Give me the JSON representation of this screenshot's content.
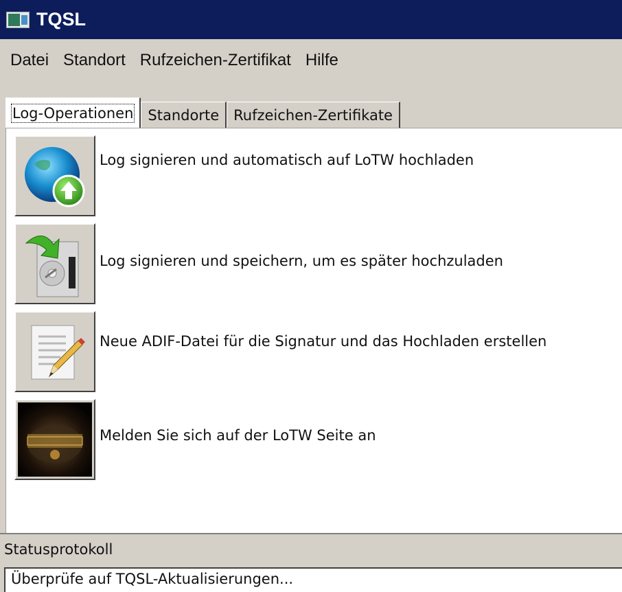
{
  "window": {
    "title": "TQSL"
  },
  "menu": {
    "items": [
      "Datei",
      "Standort",
      "Rufzeichen-Zertifikat",
      "Hilfe"
    ]
  },
  "tabs": [
    {
      "label": "Log-Operationen",
      "active": true
    },
    {
      "label": "Standorte",
      "active": false
    },
    {
      "label": "Rufzeichen-Zertifikate",
      "active": false
    }
  ],
  "operations": [
    {
      "icon": "globe-upload-icon",
      "label": "Log signieren und automatisch auf LoTW hochladen"
    },
    {
      "icon": "save-to-disk-icon",
      "label": "Log signieren und speichern, um es später hochzuladen"
    },
    {
      "icon": "edit-document-icon",
      "label": "Neue ADIF-Datei für die Signatur und das Hochladen erstellen"
    },
    {
      "icon": "logbook-icon",
      "label": "Melden Sie sich auf der LoTW Seite an"
    }
  ],
  "status": {
    "label": "Statusprotokoll",
    "log_text": "Überprüfe auf TQSL-Aktualisierungen..."
  }
}
